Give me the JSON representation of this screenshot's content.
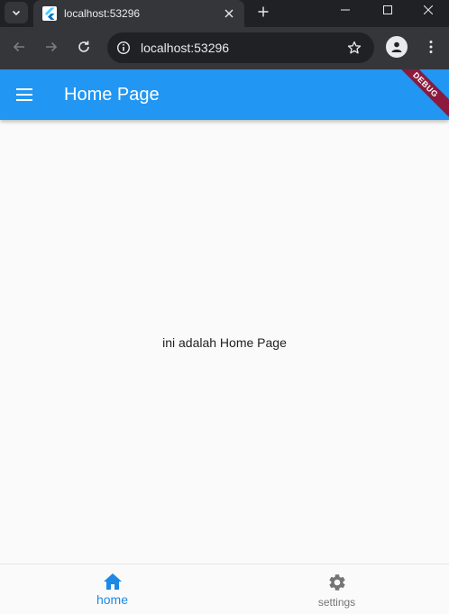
{
  "browser": {
    "tab": {
      "title": "localhost:53296",
      "favicon": "flutter-icon"
    },
    "omnibox": {
      "url": "localhost:53296"
    },
    "icons": {
      "tab_list": "chevron-down-icon",
      "tab_close": "close-icon",
      "new_tab": "plus-icon",
      "minimize": "minimize-icon",
      "maximize": "maximize-icon",
      "close_window": "close-icon",
      "back": "back-arrow-icon",
      "forward": "forward-arrow-icon",
      "reload": "reload-icon",
      "site_info": "info-icon",
      "bookmark": "star-icon",
      "profile": "profile-icon",
      "menu": "kebab-menu-icon"
    }
  },
  "app": {
    "appbar": {
      "title": "Home Page",
      "menu_icon": "hamburger-menu-icon"
    },
    "debug_banner": "DEBUG",
    "body": {
      "text": "ini adalah Home Page"
    },
    "bottom_nav": {
      "items": [
        {
          "label": "home",
          "icon": "home-icon",
          "selected": true
        },
        {
          "label": "settings",
          "icon": "gear-icon",
          "selected": false
        }
      ]
    },
    "colors": {
      "primary": "#2196f3",
      "banner": "#8b1a3e",
      "nav_selected": "#1e88e5",
      "nav_unselected": "#757575",
      "background": "#fafafa"
    }
  }
}
